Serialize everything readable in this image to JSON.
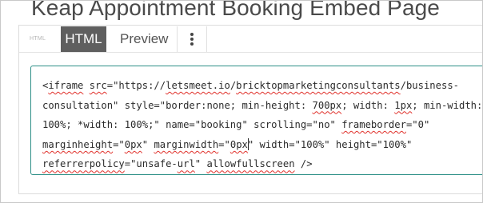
{
  "page": {
    "title": "Keap Appointment Booking Embed Page"
  },
  "tabs": {
    "small_label": "HTML",
    "html_label": "HTML",
    "preview_label": "Preview",
    "more_icon": "more-vertical-icon"
  },
  "editor": {
    "lines": [
      {
        "segments": [
          {
            "t": "<",
            "sq": false
          },
          {
            "t": "iframe",
            "sq": true
          },
          {
            "t": " ",
            "sq": false
          },
          {
            "t": "src",
            "sq": true
          },
          {
            "t": "=\"https://",
            "sq": false
          },
          {
            "t": "letsmeet.io",
            "sq": true
          },
          {
            "t": "/",
            "sq": false
          },
          {
            "t": "bricktopmarketingconsultants",
            "sq": true
          },
          {
            "t": "/business-",
            "sq": false
          }
        ]
      },
      {
        "segments": [
          {
            "t": "consultation\" style=\"border:none; min-height: ",
            "sq": false
          },
          {
            "t": "700px",
            "sq": true
          },
          {
            "t": "; width: ",
            "sq": false
          },
          {
            "t": "1px",
            "sq": true
          },
          {
            "t": "; min-width:",
            "sq": false
          }
        ]
      },
      {
        "segments": [
          {
            "t": "100%; *width: 100%;\" name=\"booking\" scrolling=\"no\" ",
            "sq": false
          },
          {
            "t": "frameborder",
            "sq": true
          },
          {
            "t": "=\"0\"",
            "sq": false
          }
        ]
      },
      {
        "segments": [
          {
            "t": "marginheight",
            "sq": true
          },
          {
            "t": "=\"",
            "sq": false
          },
          {
            "t": "0px",
            "sq": true
          },
          {
            "t": "\" ",
            "sq": false
          },
          {
            "t": "marginwidth",
            "sq": true
          },
          {
            "t": "=\"",
            "sq": false
          },
          {
            "t": "0px",
            "sq": true,
            "caret_after": true
          },
          {
            "t": "\" width=\"100%\" height=\"100%\"",
            "sq": false
          }
        ]
      },
      {
        "segments": [
          {
            "t": "referrerpolicy",
            "sq": true
          },
          {
            "t": "=\"unsafe-",
            "sq": false
          },
          {
            "t": "url",
            "sq": true
          },
          {
            "t": "\" ",
            "sq": false
          },
          {
            "t": "allowfullscreen",
            "sq": true
          },
          {
            "t": " />",
            "sq": false
          }
        ]
      }
    ]
  }
}
